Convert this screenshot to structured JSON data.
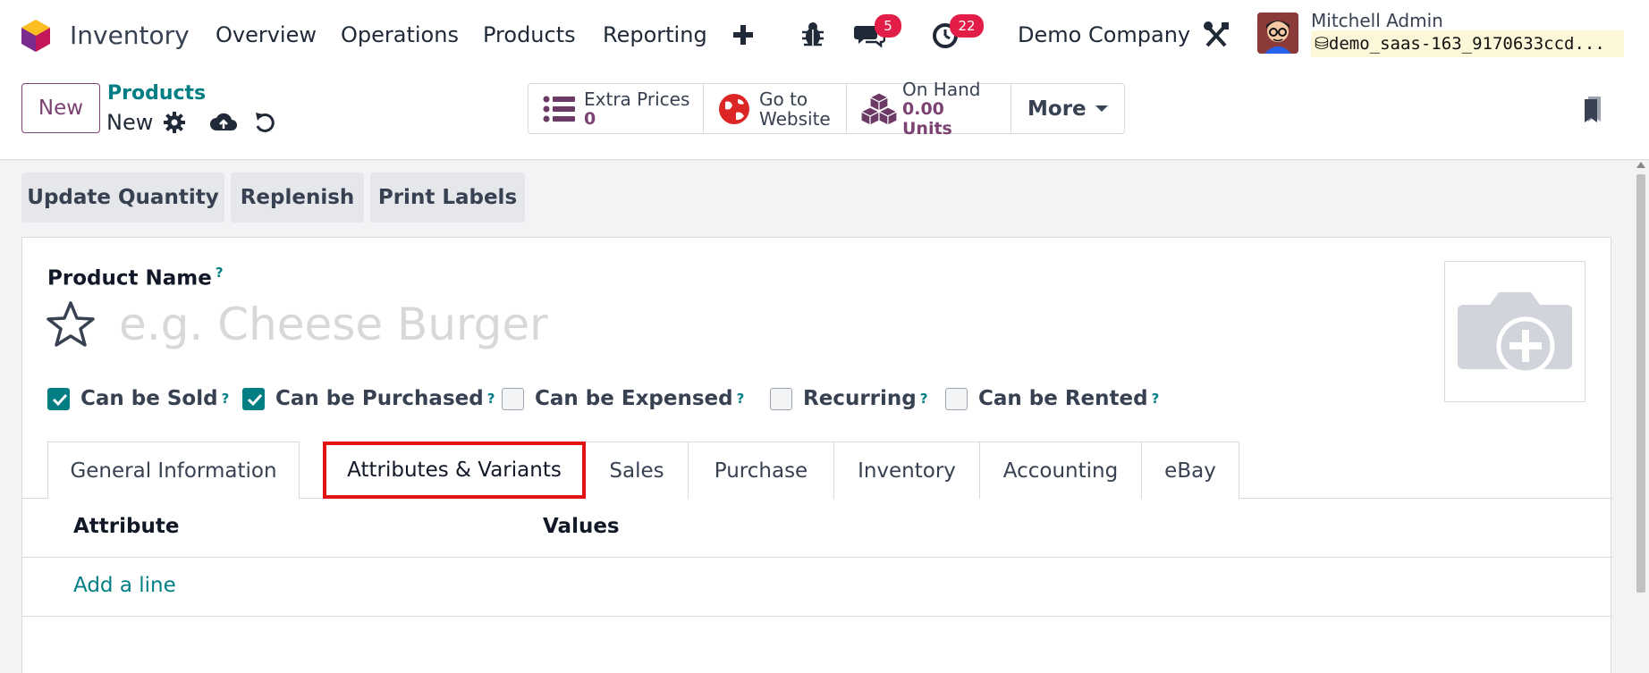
{
  "navbar": {
    "app_name": "Inventory",
    "menu": [
      "Overview",
      "Operations",
      "Products",
      "Reporting"
    ],
    "plus_icon": "plus-icon",
    "bug_icon": "bug-icon",
    "messages_badge": "5",
    "activities_badge": "22",
    "company": "Demo Company",
    "user_name": "Mitchell Admin",
    "database": "demo_saas-163_9170633ccd..."
  },
  "control_panel": {
    "new_label": "New",
    "breadcrumb": "Products",
    "record_name": "New",
    "smart_buttons": {
      "extra_prices": {
        "title": "Extra Prices",
        "value": "0"
      },
      "go_to_website": {
        "line1": "Go to",
        "line2": "Website"
      },
      "on_hand": {
        "title": "On Hand",
        "value": "0.00 Units"
      },
      "more": "More"
    }
  },
  "actions": [
    "Update Quantity",
    "Replenish",
    "Print Labels"
  ],
  "form": {
    "product_name_label": "Product Name",
    "help_mark": "?",
    "name_placeholder": "e.g. Cheese Burger",
    "checkboxes": [
      {
        "label": "Can be Sold",
        "checked": true
      },
      {
        "label": "Can be Purchased",
        "checked": true
      },
      {
        "label": "Can be Expensed",
        "checked": false
      },
      {
        "label": "Recurring",
        "checked": false
      },
      {
        "label": "Can be Rented",
        "checked": false
      }
    ],
    "tabs": [
      "General Information",
      "Attributes & Variants",
      "Sales",
      "Purchase",
      "Inventory",
      "Accounting",
      "eBay"
    ],
    "active_tab": "Attributes & Variants",
    "table_headers": {
      "attribute": "Attribute",
      "values": "Values"
    },
    "add_line": "Add a line"
  },
  "colors": {
    "brand": "#7b4272",
    "accent": "#017e84",
    "badge": "#e11d48",
    "highlight": "#e11414"
  }
}
